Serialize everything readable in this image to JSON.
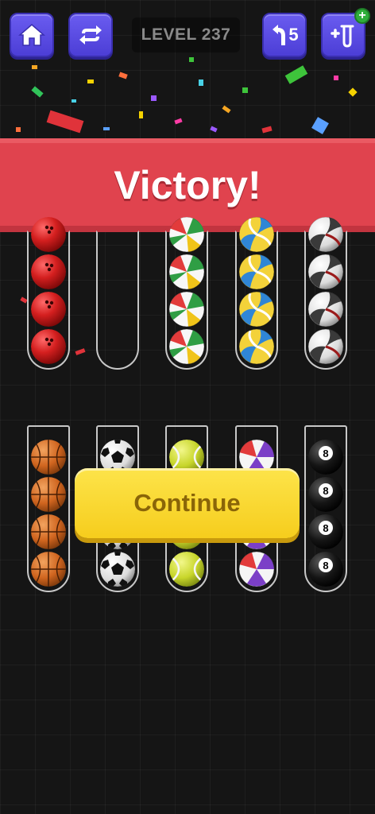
{
  "header": {
    "level_label": "LEVEL 237",
    "undo_count": "5",
    "add_tube_badge": "+",
    "icons": [
      "home-icon",
      "restart-icon",
      "undo-icon",
      "add-tube-icon"
    ]
  },
  "banner": {
    "text": "Victory!"
  },
  "continue_button": {
    "label": "Continue"
  },
  "tubes": {
    "row1": [
      [
        "bowling",
        "bowling",
        "bowling",
        "bowling"
      ],
      [],
      [
        "beach",
        "beach",
        "beach",
        "beach"
      ],
      [
        "volleyball",
        "volleyball",
        "volleyball",
        "volleyball"
      ],
      [
        "white-volleyball",
        "white-volleyball",
        "white-volleyball",
        "white-volleyball"
      ]
    ],
    "row2": [
      [
        "basketball",
        "basketball",
        "basketball",
        "basketball"
      ],
      [
        "soccer",
        "soccer",
        "soccer",
        "soccer"
      ],
      [
        "tennis",
        "tennis",
        "tennis",
        "tennis"
      ],
      [
        "beach-purple",
        "beach-purple",
        "beach-purple",
        "beach-purple"
      ],
      [
        "eight-ball",
        "eight-ball",
        "eight-ball",
        "eight-ball"
      ]
    ]
  },
  "colors": {
    "button_purple": "#5b4be8",
    "banner_red": "#e0434e",
    "continue_yellow": "#f9d92e",
    "background": "#151515"
  }
}
